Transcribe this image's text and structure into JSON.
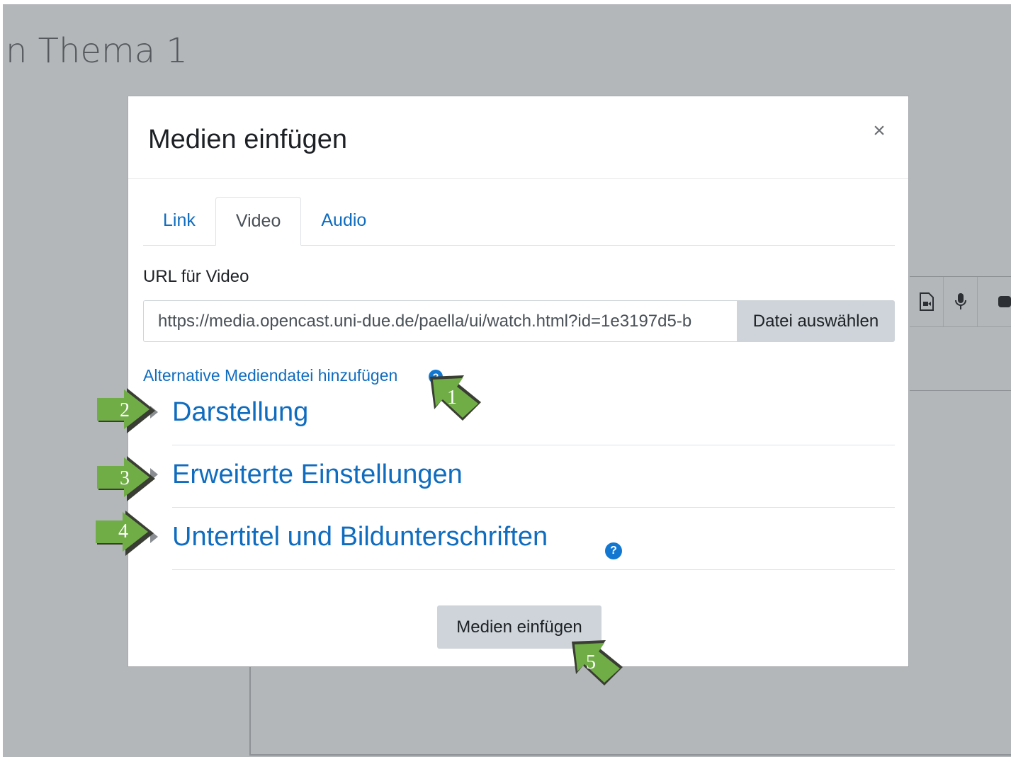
{
  "background": {
    "page_title": "n Thema 1"
  },
  "modal": {
    "title": "Medien einfügen",
    "close_symbol": "×",
    "tabs": [
      {
        "label": "Link",
        "active": false
      },
      {
        "label": "Video",
        "active": true
      },
      {
        "label": "Audio",
        "active": false
      }
    ],
    "url_label": "URL für Video",
    "url_value": "https://media.opencast.uni-due.de/paella/ui/watch.html?id=1e3197d5-b",
    "file_button": "Datei auswählen",
    "alt_link": "Alternative Mediendatei hinzufügen",
    "sections": [
      {
        "title": "Darstellung",
        "has_help": false
      },
      {
        "title": "Erweiterte Einstellungen",
        "has_help": false
      },
      {
        "title": "Untertitel und Bildunterschriften",
        "has_help": true
      }
    ],
    "submit_button": "Medien einfügen"
  },
  "callouts": [
    "1",
    "2",
    "3",
    "4",
    "5"
  ],
  "icons": {
    "help": "help-icon",
    "close": "close-icon",
    "toolbar": [
      "video-file-icon",
      "microphone-icon",
      "record-icon"
    ]
  },
  "colors": {
    "link": "#0f6cbf",
    "callout_fill": "#70ad47",
    "backdrop": "#b4b7ba",
    "button_bg": "#ced4da"
  }
}
